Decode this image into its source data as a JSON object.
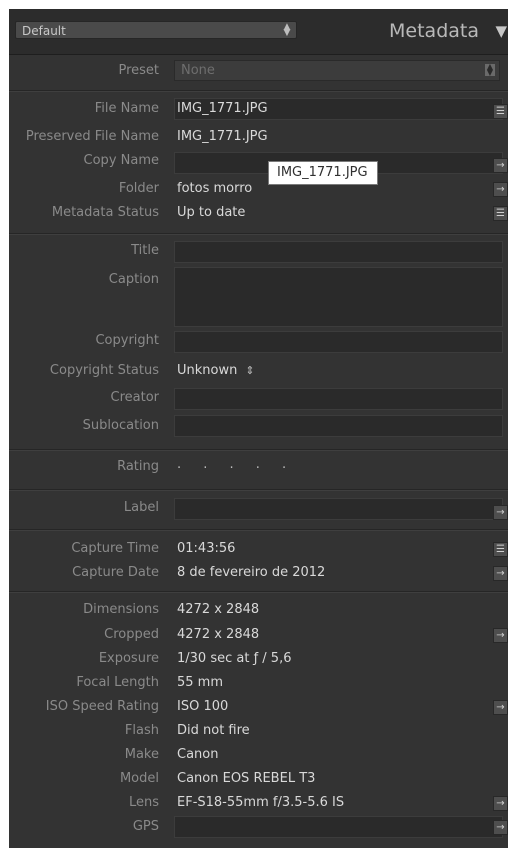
{
  "header": {
    "preset_select": "Default",
    "title": "Metadata",
    "collapse_icon": "triangle-down-icon"
  },
  "preset": {
    "label": "Preset",
    "value": "None"
  },
  "file": {
    "file_name_label": "File Name",
    "file_name": "IMG_1771.JPG",
    "preserved_label": "Preserved File Name",
    "preserved": "IMG_1771.JPG",
    "copy_name_label": "Copy Name",
    "copy_name": "",
    "folder_label": "Folder",
    "folder": "fotos morro",
    "status_label": "Metadata Status",
    "status": "Up to date"
  },
  "tooltip": "IMG_1771.JPG",
  "iptc": {
    "title_label": "Title",
    "caption_label": "Caption",
    "copyright_label": "Copyright",
    "copyright_status_label": "Copyright Status",
    "copyright_status": "Unknown",
    "creator_label": "Creator",
    "sublocation_label": "Sublocation"
  },
  "rating": {
    "label": "Rating",
    "value": ". . . . ."
  },
  "label": {
    "label": "Label"
  },
  "capture": {
    "time_label": "Capture Time",
    "time": "01:43:56",
    "date_label": "Capture Date",
    "date": "8 de fevereiro de 2012"
  },
  "exif": {
    "dimensions_label": "Dimensions",
    "dimensions": "4272 x 2848",
    "cropped_label": "Cropped",
    "cropped": "4272 x 2848",
    "exposure_label": "Exposure",
    "exposure": "1/30 sec at ƒ / 5,6",
    "focal_label": "Focal Length",
    "focal": "55 mm",
    "iso_label": "ISO Speed Rating",
    "iso": "ISO 100",
    "flash_label": "Flash",
    "flash": "Did not fire",
    "make_label": "Make",
    "make": "Canon",
    "model_label": "Model",
    "model": "Canon EOS REBEL T3",
    "lens_label": "Lens",
    "lens": "EF-S18-55mm f/3.5-5.6 IS",
    "gps_label": "GPS",
    "gps": ""
  },
  "colors": {
    "panel_bg": "#333333",
    "label_text": "#8a8a8a",
    "value_text": "#d9d9d9"
  }
}
